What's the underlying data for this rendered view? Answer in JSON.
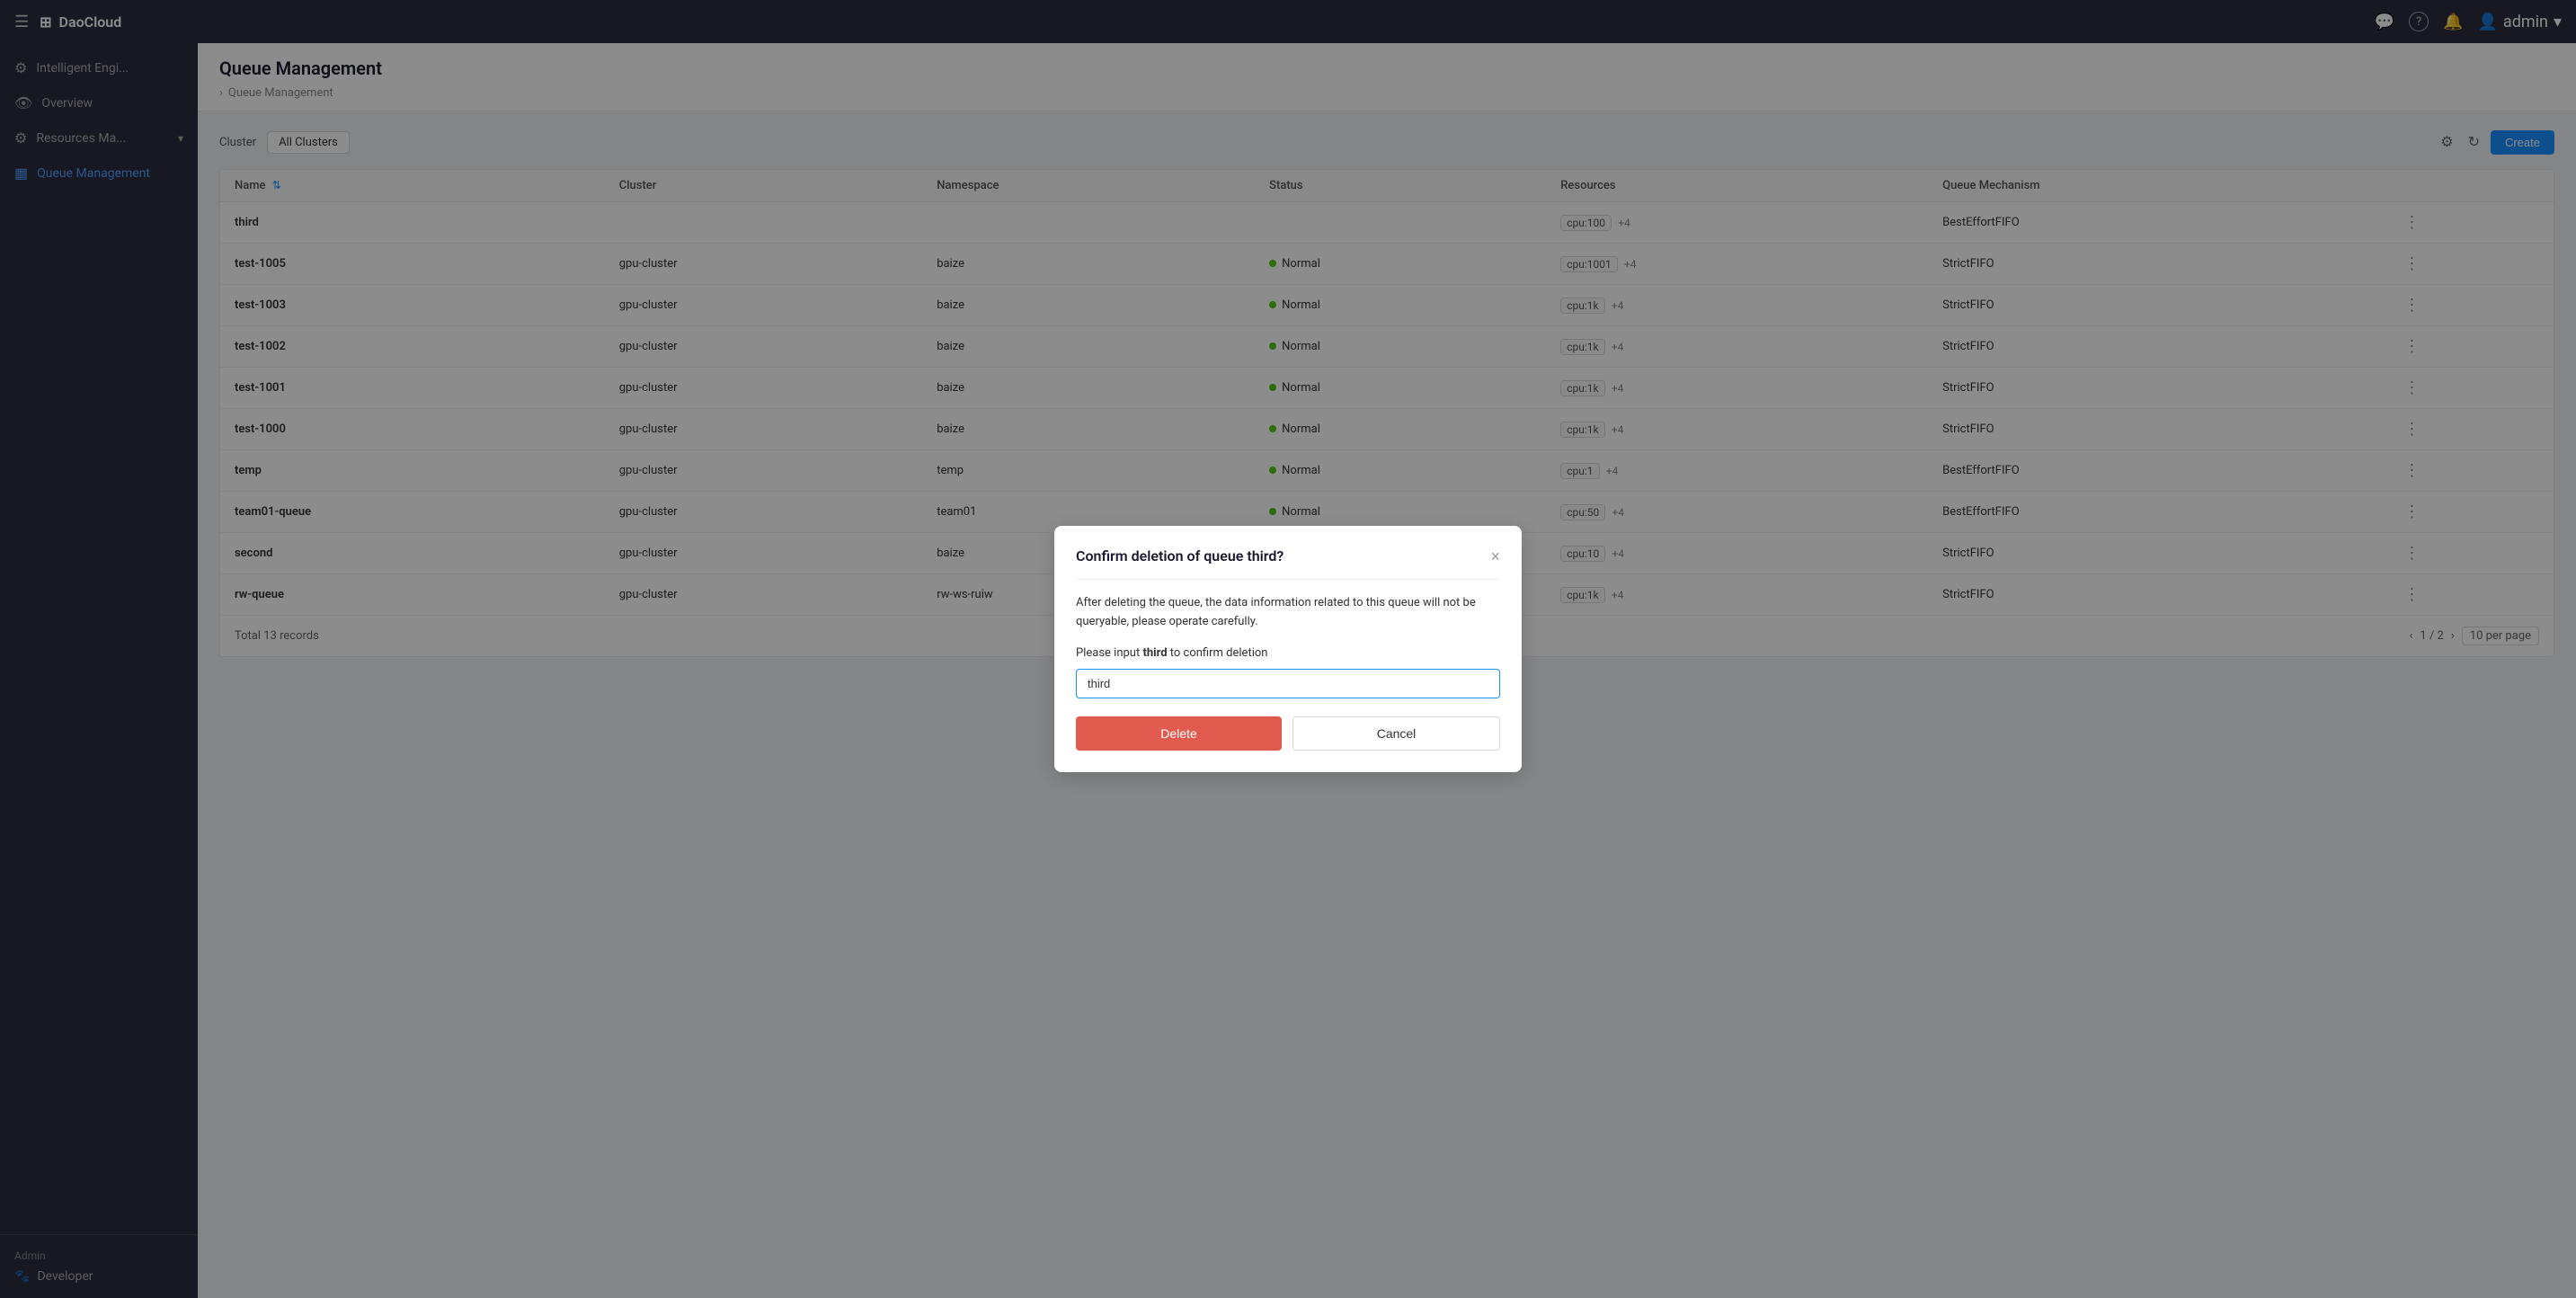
{
  "app": {
    "name": "DaoCloud",
    "hamburger": "☰",
    "logo_symbol": "⊞"
  },
  "navbar": {
    "title": "DaoCloud",
    "message_icon": "💬",
    "help_icon": "?",
    "notification_icon": "🔔",
    "user_icon": "👤",
    "username": "admin",
    "chevron": "▾"
  },
  "sidebar": {
    "main_item": {
      "icon": "⚙",
      "label": "Intelligent Engi..."
    },
    "items": [
      {
        "id": "overview",
        "icon": "👁",
        "label": "Overview",
        "active": false
      },
      {
        "id": "resources",
        "icon": "⚙",
        "label": "Resources Ma...",
        "active": false,
        "has_chevron": true
      },
      {
        "id": "queue",
        "icon": "▦",
        "label": "Queue Management",
        "active": true
      }
    ],
    "bottom": {
      "admin_label": "Admin",
      "developer_icon": "🐾",
      "developer_label": "Developer"
    }
  },
  "page": {
    "title": "Queue Management",
    "breadcrumb_parent": "Queue Management",
    "breadcrumb_sep": "›"
  },
  "toolbar": {
    "cluster_label": "Cluster",
    "cluster_value": "All Clusters",
    "settings_icon": "⚙",
    "refresh_icon": "↻",
    "create_label": "Create"
  },
  "table": {
    "columns": [
      {
        "key": "name",
        "label": "Name",
        "sort": true
      },
      {
        "key": "cluster",
        "label": "Cluster"
      },
      {
        "key": "namespace",
        "label": "Namespace"
      },
      {
        "key": "status",
        "label": "Status"
      },
      {
        "key": "resources",
        "label": "Resources"
      },
      {
        "key": "mechanism",
        "label": "Queue Mechanism"
      },
      {
        "key": "actions",
        "label": ""
      }
    ],
    "rows": [
      {
        "name": "third",
        "cluster": "",
        "namespace": "",
        "status": "",
        "resources": "cpu:100",
        "resources_more": "+4",
        "mechanism": "BestEffortFIFO"
      },
      {
        "name": "test-1005",
        "cluster": "gpu-cluster",
        "namespace": "baize",
        "status": "Normal",
        "resources": "cpu:1001",
        "resources_more": "+4",
        "mechanism": "StrictFIFO"
      },
      {
        "name": "test-1003",
        "cluster": "gpu-cluster",
        "namespace": "baize",
        "status": "Normal",
        "resources": "cpu:1k",
        "resources_more": "+4",
        "mechanism": "StrictFIFO"
      },
      {
        "name": "test-1002",
        "cluster": "gpu-cluster",
        "namespace": "baize",
        "status": "Normal",
        "resources": "cpu:1k",
        "resources_more": "+4",
        "mechanism": "StrictFIFO"
      },
      {
        "name": "test-1001",
        "cluster": "gpu-cluster",
        "namespace": "baize",
        "status": "Normal",
        "resources": "cpu:1k",
        "resources_more": "+4",
        "mechanism": "StrictFIFO"
      },
      {
        "name": "test-1000",
        "cluster": "gpu-cluster",
        "namespace": "baize",
        "status": "Normal",
        "resources": "cpu:1k",
        "resources_more": "+4",
        "mechanism": "StrictFIFO"
      },
      {
        "name": "temp",
        "cluster": "gpu-cluster",
        "namespace": "temp",
        "status": "Normal",
        "resources": "cpu:1",
        "resources_more": "+4",
        "mechanism": "BestEffortFIFO"
      },
      {
        "name": "team01-queue",
        "cluster": "gpu-cluster",
        "namespace": "team01",
        "status": "Normal",
        "resources": "cpu:50",
        "resources_more": "+4",
        "mechanism": "BestEffortFIFO"
      },
      {
        "name": "second",
        "cluster": "gpu-cluster",
        "namespace": "baize",
        "status": "Normal",
        "resources": "cpu:10",
        "resources_more": "+4",
        "mechanism": "StrictFIFO"
      },
      {
        "name": "rw-queue",
        "cluster": "gpu-cluster",
        "namespace": "rw-ws-ruiw",
        "status": "Normal",
        "resources": "cpu:1k",
        "resources_more": "+4",
        "mechanism": "StrictFIFO"
      }
    ],
    "footer": {
      "total_label": "Total 13 records",
      "page_info": "1 / 2",
      "per_page": "10 per page",
      "prev_icon": "‹",
      "next_icon": "›"
    }
  },
  "modal": {
    "title": "Confirm deletion of queue third?",
    "close_icon": "×",
    "warning_text": "After deleting the queue, the data information related to this queue will not be queryable, please operate carefully.",
    "input_label_prefix": "Please input ",
    "input_label_bold": "third",
    "input_label_suffix": " to confirm deletion",
    "input_placeholder": "third",
    "input_value": "third",
    "delete_label": "Delete",
    "cancel_label": "Cancel"
  },
  "colors": {
    "primary": "#1890ff",
    "danger": "#e05a4e",
    "success": "#52c41a",
    "navbar_bg": "#2c2c3e",
    "sidebar_bg": "#2c2c3e",
    "page_bg": "#f0f2f5"
  }
}
